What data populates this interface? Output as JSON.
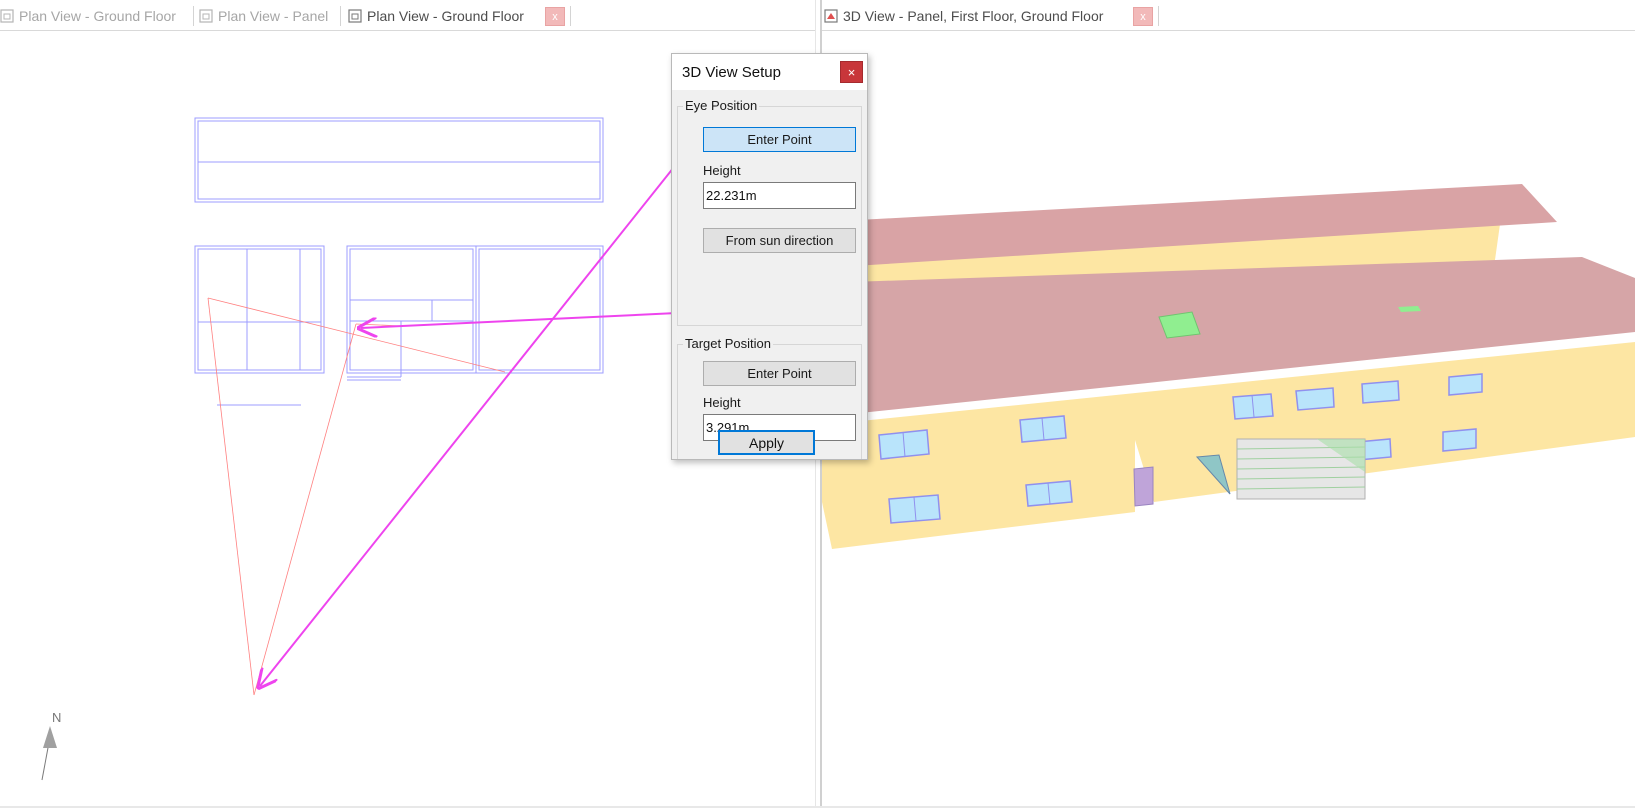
{
  "left_tabs": [
    {
      "label": "Plan View - Ground Floor",
      "active": false
    },
    {
      "label": "Plan View - Panel",
      "active": false
    },
    {
      "label": "Plan View - Ground Floor",
      "active": true
    }
  ],
  "right_tabs": [
    {
      "label": "3D View - Panel, First Floor, Ground Floor",
      "active": true
    }
  ],
  "tab_close_glyph": "x",
  "plan": {
    "north_label": "N"
  },
  "dialog": {
    "title": "3D View Setup",
    "close_glyph": "×",
    "eye": {
      "group_label": "Eye Position",
      "enter_point_label": "Enter Point",
      "height_label": "Height",
      "height_value": "22.231m",
      "sun_button_label": "From sun direction"
    },
    "target": {
      "group_label": "Target Position",
      "enter_point_label": "Enter Point",
      "height_label": "Height",
      "height_value": "3.291m"
    },
    "apply_label": "Apply"
  },
  "colors": {
    "plan_lines": "#9c9cff",
    "view_lines": "#ff8080",
    "arrows": "#ee44ee",
    "roof": "#d9a3a5",
    "wall": "#fde6a3",
    "gable": "#8b0d10",
    "gable_side": "#e0a800",
    "window_glass": "#b9e4fb",
    "skylight": "#90ee90",
    "door": "#bfa4d9"
  },
  "icons": {
    "tab_icon": "plan-view-icon",
    "view3d_icon": "3d-view-icon",
    "north_arrow": "north-arrow-icon"
  }
}
